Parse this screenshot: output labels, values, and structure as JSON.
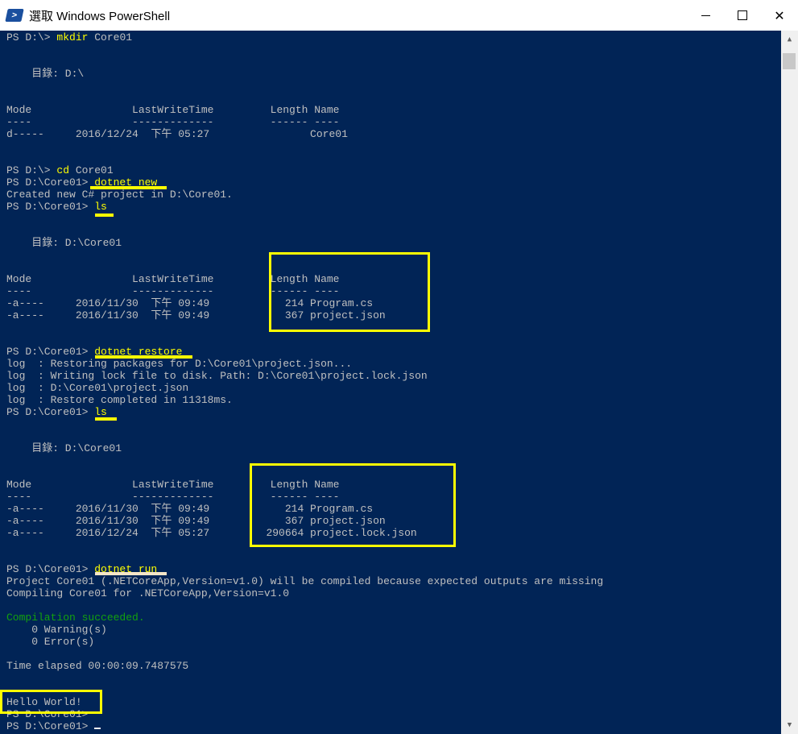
{
  "window": {
    "title": "選取 Windows PowerShell",
    "icon": "powershell-icon",
    "minimize_glyph": "",
    "maximize_glyph": "",
    "close_glyph": "✕"
  },
  "colors": {
    "console_bg": "#012456",
    "text": "#c0c0c0",
    "command": "#ffff00",
    "success": "#13a10e",
    "highlight_yellow": "#ffff00",
    "highlight_cream": "#f5e6c8"
  },
  "console": {
    "lines": [
      {
        "prompt": "PS D:\\> ",
        "cmd": "mkdir",
        "rest": " Core01"
      },
      {
        "text": ""
      },
      {
        "text": ""
      },
      {
        "text": "    目錄: D:\\"
      },
      {
        "text": ""
      },
      {
        "text": ""
      },
      {
        "text": "Mode                LastWriteTime         Length Name"
      },
      {
        "text": "----                -------------         ------ ----"
      },
      {
        "text": "d-----     2016/12/24  下午 05:27                Core01"
      },
      {
        "text": ""
      },
      {
        "text": ""
      },
      {
        "prompt": "PS D:\\> ",
        "cmd": "cd",
        "rest": " Core01"
      },
      {
        "prompt": "PS D:\\Core01> ",
        "cmd": "dotnet new",
        "rest": ""
      },
      {
        "text": "Created new C# project in D:\\Core01."
      },
      {
        "prompt": "PS D:\\Core01> ",
        "cmd": "ls",
        "rest": ""
      },
      {
        "text": ""
      },
      {
        "text": ""
      },
      {
        "text": "    目錄: D:\\Core01"
      },
      {
        "text": ""
      },
      {
        "text": ""
      },
      {
        "text": "Mode                LastWriteTime         Length Name"
      },
      {
        "text": "----                -------------         ------ ----"
      },
      {
        "text": "-a----     2016/11/30  下午 09:49            214 Program.cs"
      },
      {
        "text": "-a----     2016/11/30  下午 09:49            367 project.json"
      },
      {
        "text": ""
      },
      {
        "text": ""
      },
      {
        "prompt": "PS D:\\Core01> ",
        "cmd": "dotnet restore",
        "rest": ""
      },
      {
        "text": "log  : Restoring packages for D:\\Core01\\project.json..."
      },
      {
        "text": "log  : Writing lock file to disk. Path: D:\\Core01\\project.lock.json"
      },
      {
        "text": "log  : D:\\Core01\\project.json"
      },
      {
        "text": "log  : Restore completed in 11318ms."
      },
      {
        "prompt": "PS D:\\Core01> ",
        "cmd": "ls",
        "rest": ""
      },
      {
        "text": ""
      },
      {
        "text": ""
      },
      {
        "text": "    目錄: D:\\Core01"
      },
      {
        "text": ""
      },
      {
        "text": ""
      },
      {
        "text": "Mode                LastWriteTime         Length Name"
      },
      {
        "text": "----                -------------         ------ ----"
      },
      {
        "text": "-a----     2016/11/30  下午 09:49            214 Program.cs"
      },
      {
        "text": "-a----     2016/11/30  下午 09:49            367 project.json"
      },
      {
        "text": "-a----     2016/12/24  下午 05:27         290664 project.lock.json"
      },
      {
        "text": ""
      },
      {
        "text": ""
      },
      {
        "prompt": "PS D:\\Core01> ",
        "cmd": "dotnet run",
        "rest": ""
      },
      {
        "text": "Project Core01 (.NETCoreApp,Version=v1.0) will be compiled because expected outputs are missing"
      },
      {
        "text": "Compiling Core01 for .NETCoreApp,Version=v1.0"
      },
      {
        "text": ""
      },
      {
        "success": "Compilation succeeded."
      },
      {
        "text": "    0 Warning(s)"
      },
      {
        "text": "    0 Error(s)"
      },
      {
        "text": ""
      },
      {
        "text": "Time elapsed 00:00:09.7487575"
      },
      {
        "text": ""
      },
      {
        "text": ""
      },
      {
        "text": "Hello World!"
      },
      {
        "prompt": "PS D:\\Core01> ",
        "cmd": "",
        "rest": ""
      },
      {
        "prompt": "PS D:\\Core01> ",
        "cmd": "",
        "rest": "",
        "cursor": true
      }
    ]
  }
}
